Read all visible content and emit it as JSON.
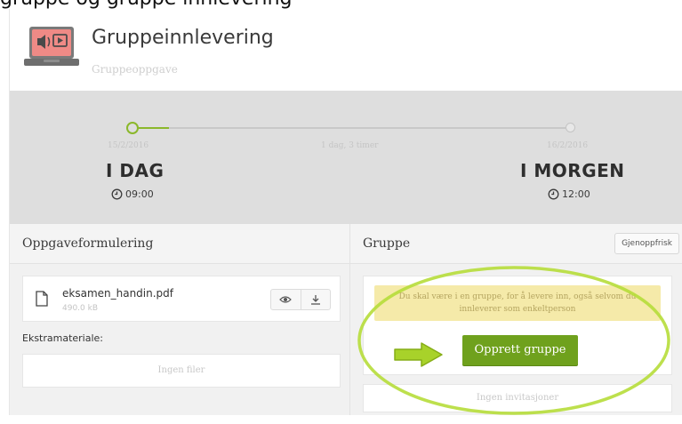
{
  "caption": "gruppe og gruppe innlevering",
  "header": {
    "title": "Gruppeinnlevering",
    "subtitle": "Gruppeoppgave",
    "icon": "laptop-media-icon"
  },
  "timeline": {
    "start": {
      "date": "15/2/2016",
      "label": "I DAG",
      "time": "09:00"
    },
    "duration": "1 dag, 3 timer",
    "end": {
      "date": "16/2/2016",
      "label": "I MORGEN",
      "time": "12:00"
    },
    "progress_fraction": 0.07,
    "accent": "#8bb82b"
  },
  "left_panel": {
    "title": "Oppgaveformulering",
    "file": {
      "name": "eksamen_handin.pdf",
      "size": "490.0 kB",
      "icons": [
        "file-icon",
        "eye-icon",
        "download-icon"
      ]
    },
    "extra_label": "Ekstramateriale:",
    "no_files": "Ingen filer"
  },
  "right_panel": {
    "title": "Gruppe",
    "refresh_label": "Gjenoppfrisk",
    "warning": "Du skal være i en gruppe, for å levere inn, også selvom du innleverer som enkeltperson",
    "create_label": "Opprett gruppe",
    "no_invites": "Ingen invitasjoner",
    "button_color": "#6fa11d",
    "annotation_color": "#a8d22a"
  }
}
